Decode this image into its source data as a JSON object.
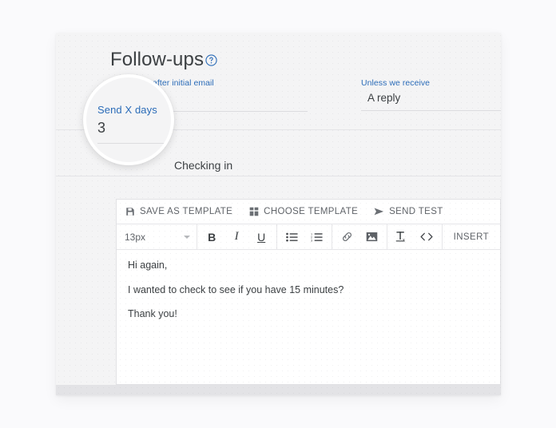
{
  "page": {
    "background_color": "#fafafc"
  },
  "card": {
    "background_color": "#f4f4f5",
    "header": {
      "title": "Follow-ups",
      "help_icon": "help-circle-icon"
    },
    "form": {
      "days_field": {
        "label": "Send X days",
        "value": "3",
        "suffix_label": "after initial email"
      },
      "condition_field": {
        "label": "Unless we receive",
        "value": "A reply"
      }
    },
    "subject": {
      "text": "Checking in"
    },
    "footer": {
      "strip_color": "#e3e3e6"
    }
  },
  "editor": {
    "actions": [
      {
        "icon": "save-icon",
        "label": "SAVE AS TEMPLATE"
      },
      {
        "icon": "grid-icon",
        "label": "CHOOSE TEMPLATE"
      },
      {
        "icon": "send-icon",
        "label": "SEND TEST"
      }
    ],
    "toolbar": {
      "font_size": "13px",
      "bold": "B",
      "italic": "I",
      "underline": "U",
      "bullet_list": "bullet-list-icon",
      "numbered_list": "numbered-list-icon",
      "link": "link-icon",
      "image": "image-icon",
      "clear_format": "clear-format-icon",
      "code": "code-icon",
      "insert_label": "INSERT"
    },
    "body": {
      "paragraphs": [
        "Hi again,",
        "I wanted to check to see if you have 15 minutes?",
        "Thank you!"
      ]
    }
  },
  "magnifier": {
    "label": "Send X days",
    "value": "3"
  },
  "colors": {
    "accent_blue": "#2b6cb8",
    "text_dark": "#3c4043",
    "text_muted": "#5f6368",
    "border": "#e1e1e4"
  }
}
